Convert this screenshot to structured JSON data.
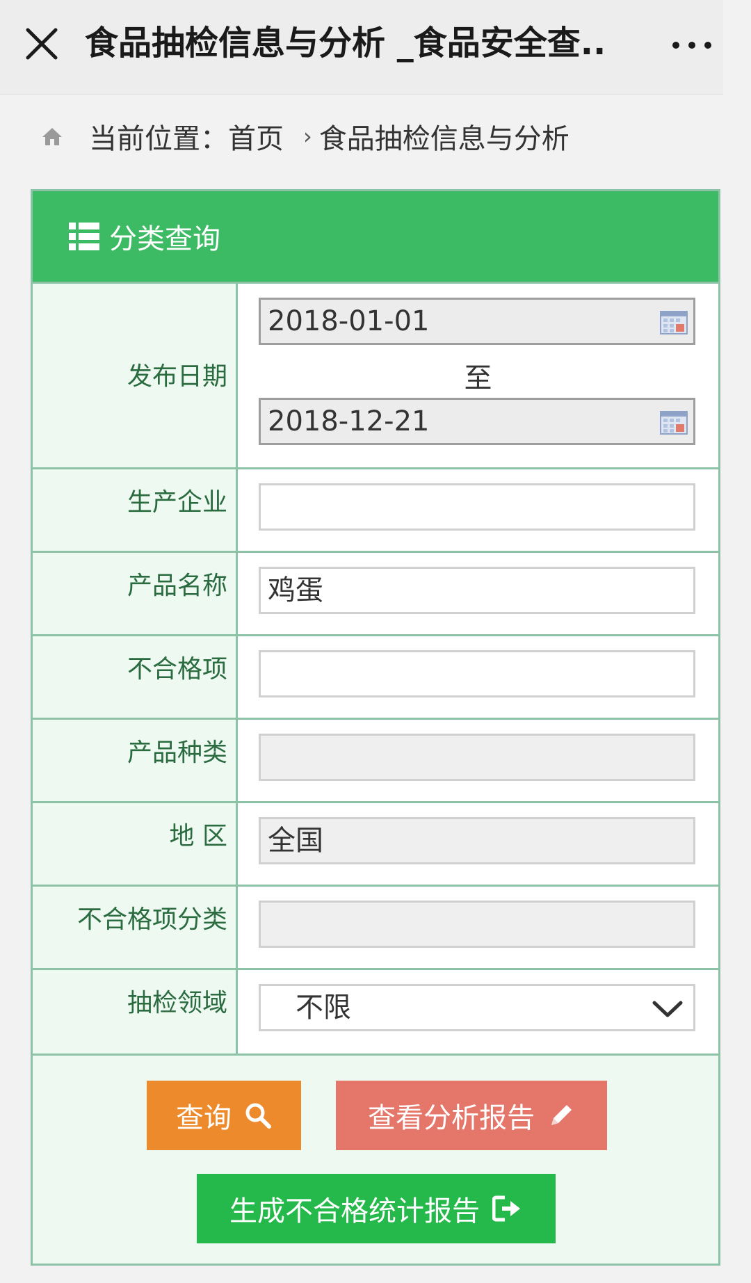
{
  "topbar": {
    "title": "食品抽检信息与分析 _食品安全查..",
    "close_icon": "close-icon",
    "more_icon": "more-icon"
  },
  "breadcrumb": {
    "prefix": "当前位置：",
    "home": "首页",
    "separator": "›",
    "current": "食品抽检信息与分析"
  },
  "panel": {
    "header": "分类查询",
    "fields": {
      "publish_date": {
        "label": "发布日期",
        "from": "2018-01-01",
        "to_text": "至",
        "to": "2018-12-21"
      },
      "manufacturer": {
        "label": "生产企业",
        "value": ""
      },
      "product_name": {
        "label": "产品名称",
        "value": "鸡蛋"
      },
      "unqualified_item": {
        "label": "不合格项",
        "value": ""
      },
      "product_category": {
        "label": "产品种类",
        "value": ""
      },
      "region": {
        "label": "地 区",
        "value": "全国"
      },
      "unqualified_category": {
        "label": "不合格项分类",
        "value": ""
      },
      "sampling_domain": {
        "label": "抽检领域",
        "value": "不限"
      }
    },
    "buttons": {
      "query": "查询",
      "view_report": "查看分析报告",
      "generate_report": "生成不合格统计报告"
    }
  },
  "colors": {
    "header_green": "#3dba64",
    "query_orange": "#ed8a2c",
    "report_red": "#e5766a",
    "generate_green": "#25b94b",
    "border_green": "#8cc3a6"
  }
}
